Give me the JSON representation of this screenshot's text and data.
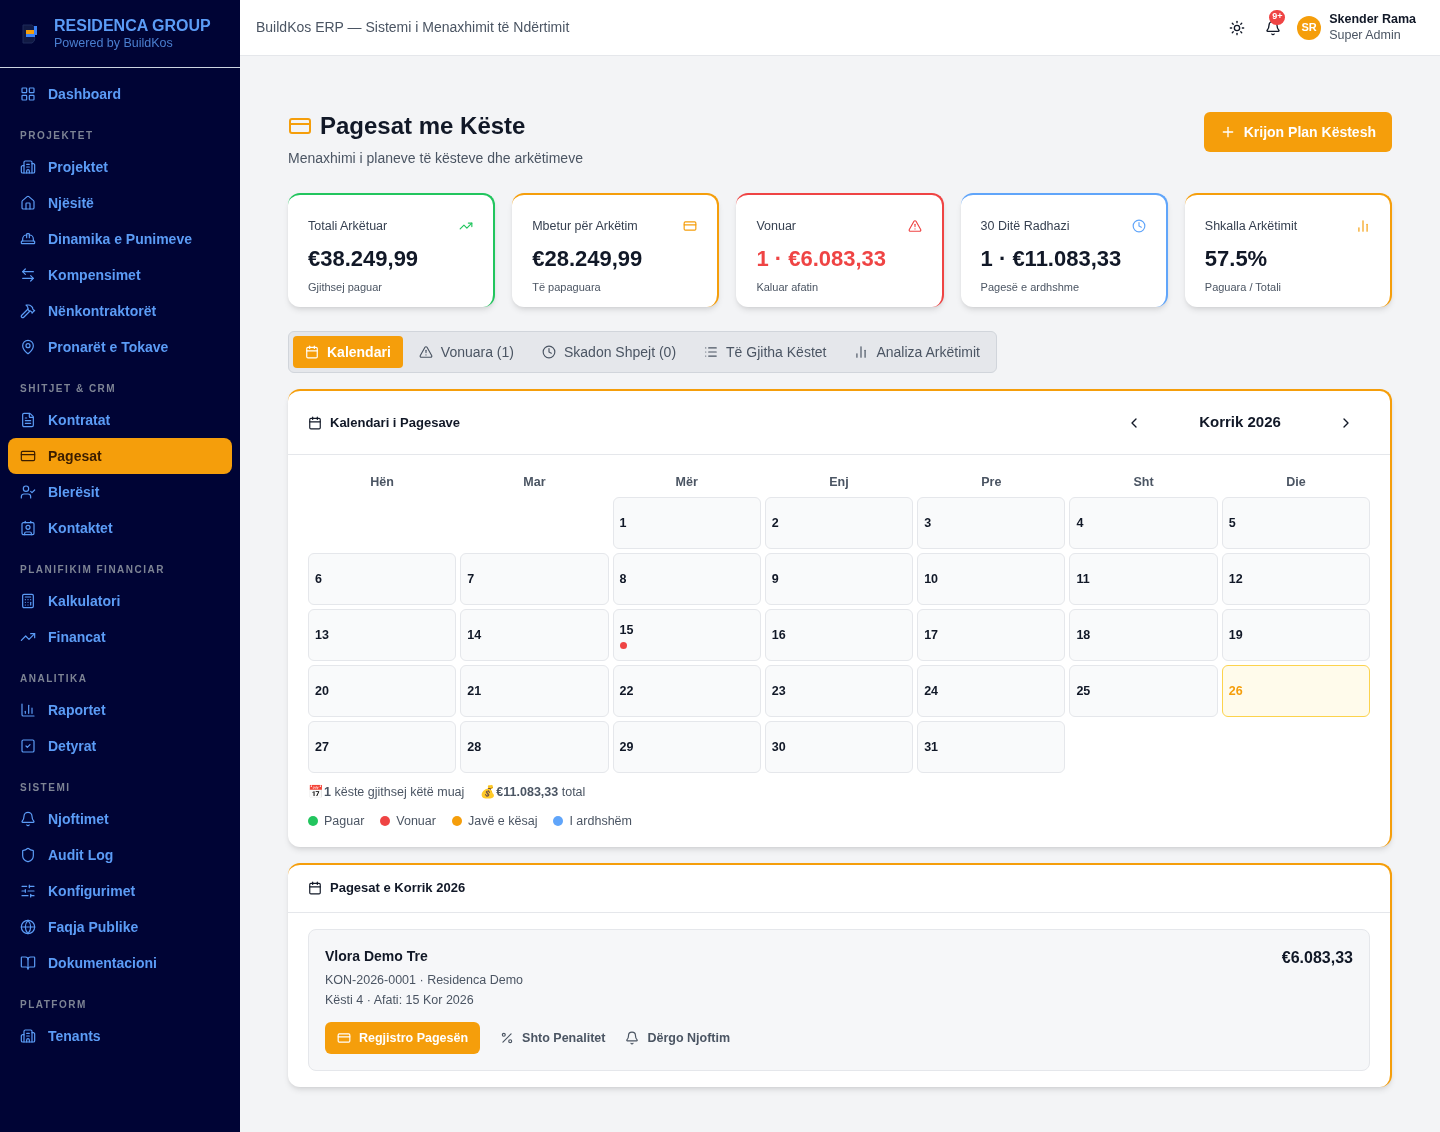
{
  "brand": {
    "name": "RESIDENCA GROUP",
    "tagline": "Powered by BuildKos"
  },
  "sidebar": {
    "top_item": {
      "label": "Dashboard",
      "selected": false
    },
    "sections": [
      {
        "title": "PROJEKTET",
        "items": [
          {
            "label": "Projektet",
            "selected": false
          },
          {
            "label": "Njësitë",
            "selected": false
          },
          {
            "label": "Dinamika e Punimeve",
            "selected": false
          },
          {
            "label": "Kompensimet",
            "selected": false
          },
          {
            "label": "Nënkontraktorët",
            "selected": false
          },
          {
            "label": "Pronarët e Tokave",
            "selected": false
          }
        ]
      },
      {
        "title": "SHITJET & CRM",
        "items": [
          {
            "label": "Kontratat",
            "selected": false
          },
          {
            "label": "Pagesat",
            "selected": true
          },
          {
            "label": "Blerësit",
            "selected": false
          },
          {
            "label": "Kontaktet",
            "selected": false
          }
        ]
      },
      {
        "title": "PLANIFIKIM FINANCIAR",
        "items": [
          {
            "label": "Kalkulatori",
            "selected": false
          },
          {
            "label": "Financat",
            "selected": false
          }
        ]
      },
      {
        "title": "ANALITIKA",
        "items": [
          {
            "label": "Raportet",
            "selected": false
          },
          {
            "label": "Detyrat",
            "selected": false
          }
        ]
      },
      {
        "title": "SISTEMI",
        "items": [
          {
            "label": "Njoftimet",
            "selected": false
          },
          {
            "label": "Audit Log",
            "selected": false
          },
          {
            "label": "Konfigurimet",
            "selected": false
          },
          {
            "label": "Faqja Publike",
            "selected": false
          },
          {
            "label": "Dokumentacioni",
            "selected": false
          }
        ]
      },
      {
        "title": "PLATFORM",
        "items": [
          {
            "label": "Tenants",
            "selected": false
          }
        ]
      }
    ]
  },
  "header": {
    "title": "BuildKos ERP — Sistemi i Menaxhimit të Ndërtimit",
    "notification_badge": "9+",
    "user": {
      "initials": "SR",
      "name": "Skender Rama",
      "role": "Super Admin"
    }
  },
  "page": {
    "title": "Pagesat me Këste",
    "subtitle": "Menaxhimi i planeve të kësteve dhe arkëtimeve",
    "primary_button": "Krijon Plan Këstesh"
  },
  "stats": [
    {
      "label": "Totali Arkëtuar",
      "value": "€38.249,99",
      "note": "Gjithsej paguar",
      "color": "#22c55e",
      "alert": false
    },
    {
      "label": "Mbetur për Arkëtim",
      "value": "€28.249,99",
      "note": "Të papaguara",
      "color": "#f59e0b",
      "alert": false
    },
    {
      "label": "Vonuar",
      "value": "1 · €6.083,33",
      "note": "Kaluar afatin",
      "color": "#ef4444",
      "alert": true
    },
    {
      "label": "30 Ditë Radhazi",
      "value": "1 · €11.083,33",
      "note": "Pagesë e ardhshme",
      "color": "#60a5fa",
      "alert": false
    },
    {
      "label": "Shkalla Arkëtimit",
      "value": "57.5%",
      "note": "Paguara / Totali",
      "color": "#f59e0b",
      "alert": false
    }
  ],
  "tabs": [
    {
      "label": "Kalendari",
      "selected": true
    },
    {
      "label": "Vonuara (1)",
      "selected": false
    },
    {
      "label": "Skadon Shpejt (0)",
      "selected": false
    },
    {
      "label": "Të Gjitha Këstet",
      "selected": false
    },
    {
      "label": "Analiza Arkëtimit",
      "selected": false
    }
  ],
  "calendar": {
    "title": "Kalendari i Pagesave",
    "month": "Korrik 2026",
    "weekdays": [
      "Hën",
      "Mar",
      "Mër",
      "Enj",
      "Pre",
      "Sht",
      "Die"
    ],
    "weeks": [
      {
        "kind": "lead",
        "days": [
          {
            "day": "1",
            "today": false
          },
          {
            "day": "2",
            "today": false
          },
          {
            "day": "3",
            "today": false
          },
          {
            "day": "4",
            "today": false
          },
          {
            "day": "5",
            "today": false
          }
        ]
      },
      {
        "kind": "full",
        "days": [
          {
            "day": "6",
            "today": false
          },
          {
            "day": "7",
            "today": false
          },
          {
            "day": "8",
            "today": false
          },
          {
            "day": "9",
            "today": false
          },
          {
            "day": "10",
            "today": false
          },
          {
            "day": "11",
            "today": false
          },
          {
            "day": "12",
            "today": false
          }
        ]
      },
      {
        "kind": "full",
        "days": [
          {
            "day": "13",
            "today": false
          },
          {
            "day": "14",
            "today": false
          },
          {
            "day": "15",
            "today": false,
            "dots": [
              {
                "color": "#ef4444"
              }
            ]
          },
          {
            "day": "16",
            "today": false
          },
          {
            "day": "17",
            "today": false
          },
          {
            "day": "18",
            "today": false
          },
          {
            "day": "19",
            "today": false
          }
        ]
      },
      {
        "kind": "full",
        "days": [
          {
            "day": "20",
            "today": false
          },
          {
            "day": "21",
            "today": false
          },
          {
            "day": "22",
            "today": false
          },
          {
            "day": "23",
            "today": false
          },
          {
            "day": "24",
            "today": false
          },
          {
            "day": "25",
            "today": false
          },
          {
            "day": "26",
            "today": true
          }
        ]
      },
      {
        "kind": "tail",
        "days": [
          {
            "day": "27",
            "today": false
          },
          {
            "day": "28",
            "today": false
          },
          {
            "day": "29",
            "today": false
          },
          {
            "day": "30",
            "today": false
          },
          {
            "day": "31",
            "today": false
          }
        ]
      }
    ],
    "summary": [
      {
        "icon": "📅",
        "text": "**1** këste gjithsej këtë muaj"
      },
      {
        "icon": "💰",
        "text": "**€11.083,33** total"
      }
    ],
    "legend": [
      {
        "label": "Paguar",
        "color": "#22c55e"
      },
      {
        "label": "Vonuar",
        "color": "#ef4444"
      },
      {
        "label": "Javë e kësaj",
        "color": "#f59e0b"
      },
      {
        "label": "I ardhshëm",
        "color": "#60a5fa"
      }
    ]
  },
  "month_payments": {
    "title": "Pagesat e Korrik 2026",
    "items": [
      {
        "buyer": "Vlora Demo Tre",
        "meta": "KON-2026-0001 · Residenca Demo",
        "due": "Kësti 4 · Afati: 15 Kor 2026",
        "amount": "€6.083,33",
        "actions": [
          "Regjistro Pagesën",
          "Shto Penalitet",
          "Dërgo Njoftim"
        ]
      }
    ]
  }
}
